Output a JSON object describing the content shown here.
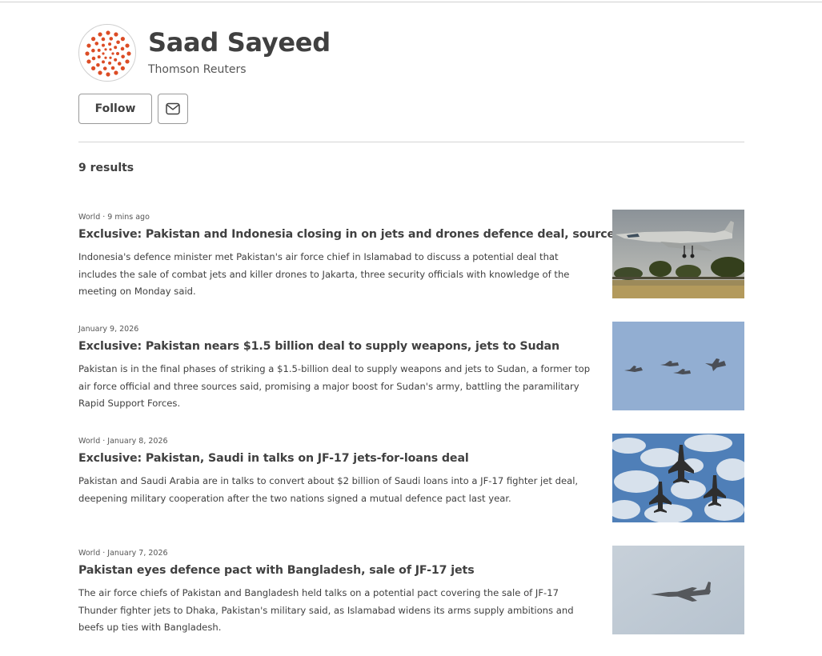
{
  "author": {
    "name": "Saad Sayeed",
    "organization": "Thomson Reuters",
    "avatar_icon": "reuters-logo-icon",
    "brand_color": "#dc4c25"
  },
  "actions": {
    "follow_label": "Follow",
    "email_icon": "envelope-icon"
  },
  "results": {
    "count_label": "9 results"
  },
  "stories": [
    {
      "section": "World",
      "time": "9 mins ago",
      "title": "Exclusive: Pakistan and Indonesia closing in on jets and drones defence deal, sources say",
      "description": "Indonesia's defence minister met Pakistan's air force chief in Islamabad to discuss a potential deal that includes the sale of combat jets and killer drones to Jakarta, three security officials with knowledge of the meeting on Monday said.",
      "image": "fighter-jet-takeoff-photo"
    },
    {
      "section": "",
      "time": "January 9, 2026",
      "title": "Exclusive: Pakistan nears $1.5 billion deal to supply weapons, jets to Sudan",
      "description": "Pakistan is in the final phases of striking a $1.5-billion deal to supply weapons and jets to Sudan, a former top air force official and three sources said, promising a major boost for Sudan's army, battling the paramilitary Rapid Support Forces.",
      "image": "jet-formation-blue-sky-photo"
    },
    {
      "section": "World",
      "time": "January 8, 2026",
      "title": "Exclusive: Pakistan, Saudi in talks on JF-17 jets-for-loans deal",
      "description": "Pakistan and Saudi Arabia are in talks to convert about $2 billion of Saudi loans into a JF-17 fighter jet deal, deepening military cooperation after the two nations signed a mutual defence pact last year.",
      "image": "jets-cloudy-sky-photo"
    },
    {
      "section": "World",
      "time": "January 7, 2026",
      "title": "Pakistan eyes defence pact with Bangladesh, sale of JF-17 jets",
      "description": "The air force chiefs of Pakistan and Bangladesh held talks on a potential pact covering the sale of JF-17 Thunder fighter jets to Dhaka, Pakistan's military said, as Islamabad widens its arms supply ambitions and beefs up ties with Bangladesh.",
      "image": "single-jet-grey-sky-photo"
    }
  ]
}
